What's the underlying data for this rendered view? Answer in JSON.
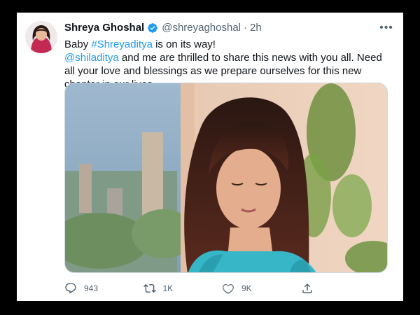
{
  "tweet": {
    "display_name": "Shreya Ghoshal",
    "handle": "@shreyaghoshal",
    "separator": "·",
    "time": "2h",
    "more_label": "•••",
    "line1_prefix": "Baby ",
    "hashtag": "#Shreyaditya",
    "line1_suffix": " is on its way!",
    "mention": "@shiladitya",
    "line2_text": " and me are thrilled to share this news with you all. Need all your love and blessings as we prepare ourselves for this new chapter in our lives."
  },
  "actions": {
    "reply_count": "943",
    "retweet_count": "1K",
    "like_count": "9K"
  },
  "icons": {
    "verified": "verified-badge-icon",
    "reply": "reply-icon",
    "retweet": "retweet-icon",
    "like": "like-icon",
    "share": "share-icon",
    "more": "more-icon"
  },
  "colors": {
    "link": "#1d9bf0",
    "secondary_text": "#536471",
    "primary_text": "#0f1419"
  }
}
